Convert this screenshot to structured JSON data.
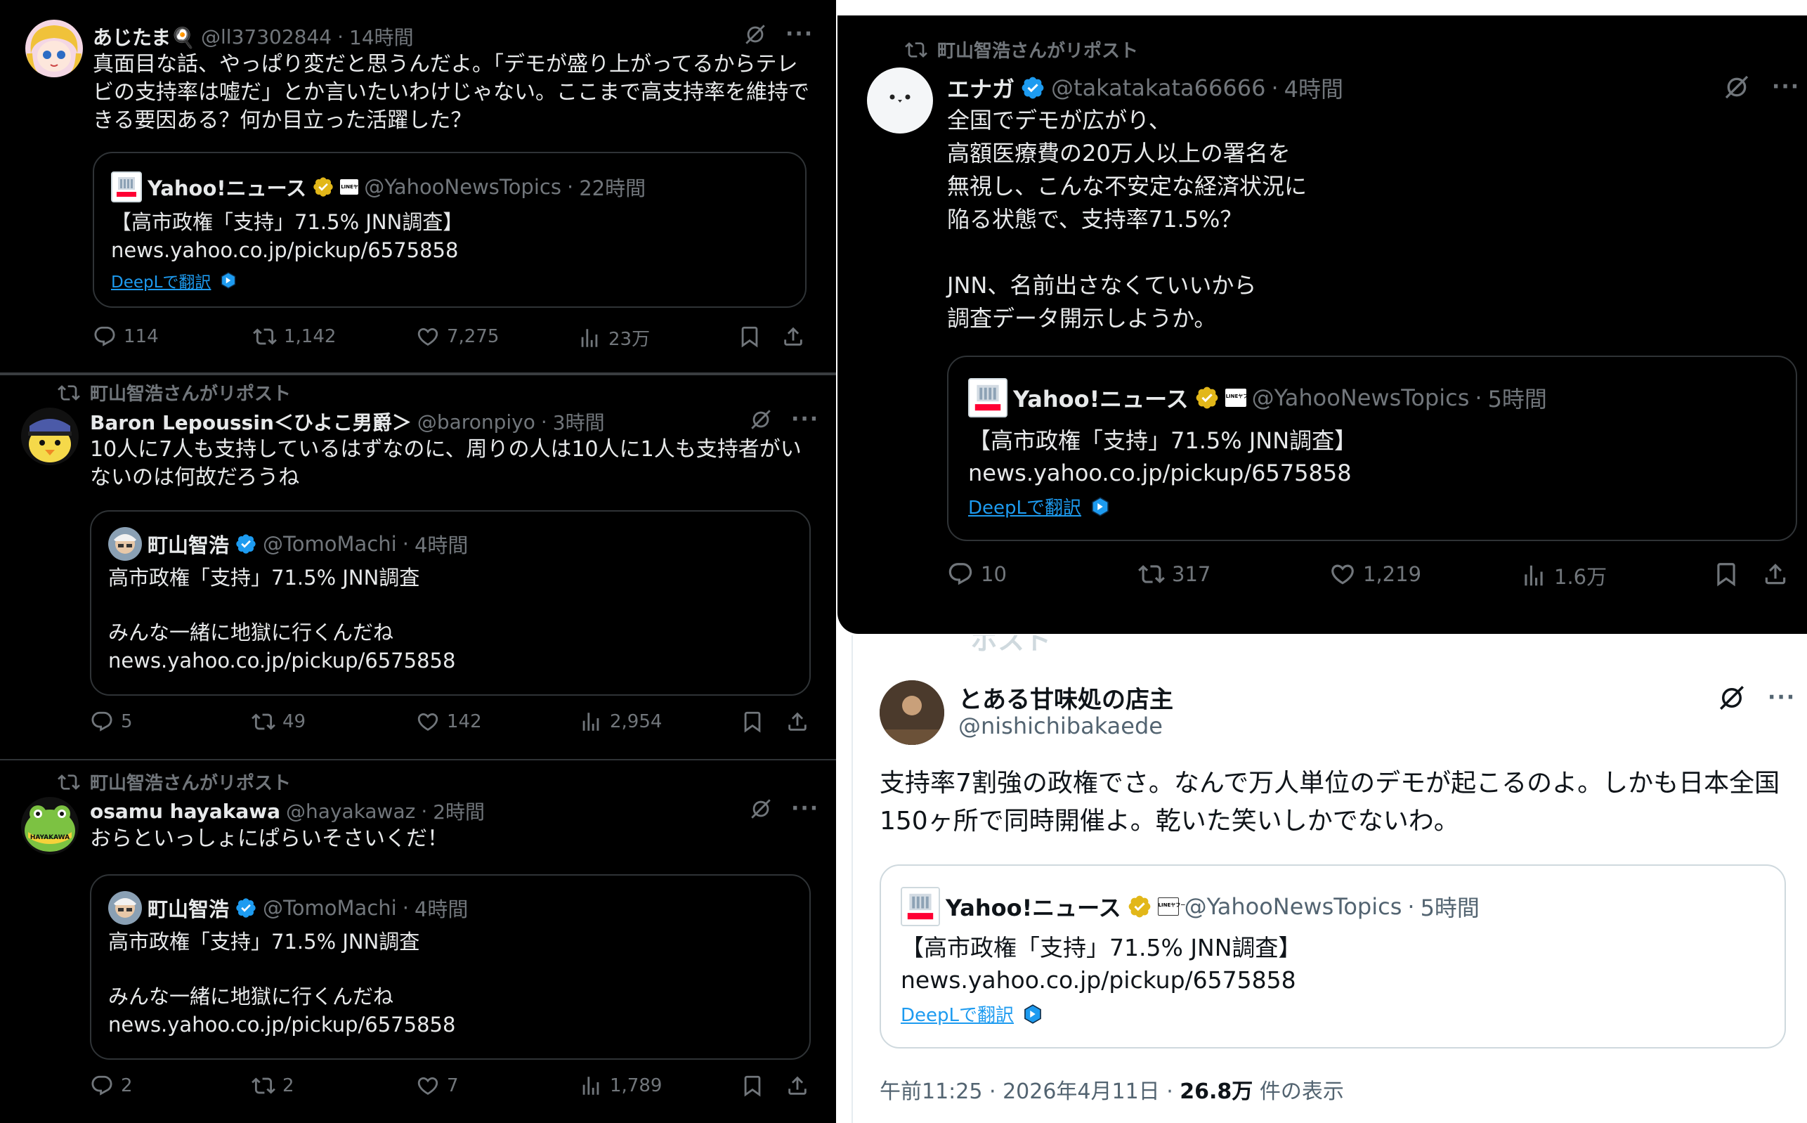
{
  "p1": {
    "author_name": "あじたま🍳",
    "handle": "@ll37302844",
    "time": "14時間",
    "text": "真面目な話、やっぱり変だと思うんだよ。「デモが盛り上がってるからテレビの支持率は嘘だ」とか言いたいわけじゃない。ここまで高支持率を維持できる要因ある？何か目立った活躍した？",
    "quote": {
      "name": "Yahoo!ニュース",
      "handle": "@YahooNewsTopics",
      "time": "22時間",
      "line1": "【高市政権「支持」71.5% JNN調査】",
      "line2": "news.yahoo.co.jp/pickup/6575858",
      "deepl": "DeepLで翻訳"
    },
    "stats": {
      "replies": "114",
      "reposts": "1,142",
      "likes": "7,275",
      "views": "23万"
    }
  },
  "p2": {
    "repost_label": "町山智浩さんがリポスト",
    "author_name": "Baron Lepoussin＜ひよこ男爵＞",
    "handle": "@baronpiyo",
    "time": "3時間",
    "text": "10人に7人も支持しているはずなのに、周りの人は10人に1人も支持者がいないのは何故だろうね",
    "quote": {
      "name": "町山智浩",
      "handle": "@TomoMachi",
      "time": "4時間",
      "line1": "高市政権「支持」71.5% JNN調査",
      "line2": "みんな一緒に地獄に行くんだね",
      "line3": "news.yahoo.co.jp/pickup/6575858"
    },
    "stats": {
      "replies": "5",
      "reposts": "49",
      "likes": "142",
      "views": "2,954"
    }
  },
  "p3": {
    "repost_label": "町山智浩さんがリポスト",
    "author_name": "osamu hayakawa",
    "handle": "@hayakawaz",
    "time": "2時間",
    "text": "おらといっしょにぱらいそさいくだ！",
    "avatar_text": "HAYAKAWA",
    "quote": {
      "name": "町山智浩",
      "handle": "@TomoMachi",
      "time": "4時間",
      "line1": "高市政権「支持」71.5% JNN調査",
      "line2": "みんな一緒に地獄に行くんだね",
      "line3": "news.yahoo.co.jp/pickup/6575858"
    },
    "stats": {
      "replies": "2",
      "reposts": "2",
      "likes": "7",
      "views": "1,789"
    }
  },
  "p4": {
    "repost_label": "町山智浩さんがリポスト",
    "author_name": "エナガ",
    "handle": "@takatakata66666",
    "time": "4時間",
    "text": "全国でデモが広がり、\n高額医療費の20万人以上の署名を\n無視し、こんな不安定な経済状況に\n陥る状態で、支持率71.5%？\n\nJNN、名前出さなくていいから\n調査データ開示しようか。",
    "quote": {
      "name": "Yahoo!ニュース",
      "handle": "@YahooNewsTopics",
      "time": "5時間",
      "line1": "【高市政権「支持」71.5% JNN調査】",
      "line2": "news.yahoo.co.jp/pickup/6575858",
      "deepl": "DeepLで翻訳"
    },
    "stats": {
      "replies": "10",
      "reposts": "317",
      "likes": "1,219",
      "views": "1.6万"
    }
  },
  "p5": {
    "header_fragment": "ポスト",
    "author_name": "とある甘味処の店主",
    "handle": "@nishichibakaede",
    "text": "支持率7割強の政権でさ。なんで万人単位のデモが起こるのよ。しかも日本全国150ヶ所で同時開催よ。乾いた笑いしかでないわ。",
    "quote": {
      "name": "Yahoo!ニュース",
      "handle": "@YahooNewsTopics",
      "time": "5時間",
      "line1": "【高市政権「支持」71.5% JNN調査】",
      "line2": "news.yahoo.co.jp/pickup/6575858",
      "deepl": "DeepLで翻訳"
    },
    "timestamp": "午前11:25 · 2026年4月11日 · ",
    "views_count": "26.8万",
    "views_label": " 件の表示"
  },
  "colors": {
    "background_dark": "#000000",
    "text_primary": "#e7e9ea",
    "text_secondary": "#71767b",
    "verified_blue": "#1d9bf0",
    "verified_gold": "#e2b719",
    "link_blue": "#1d9bf0"
  },
  "icons": [
    "repost-icon",
    "reply-icon",
    "like-icon",
    "views-icon",
    "bookmark-icon",
    "share-icon",
    "grok-icon",
    "more-icon",
    "verified-icon",
    "deepl-icon"
  ]
}
